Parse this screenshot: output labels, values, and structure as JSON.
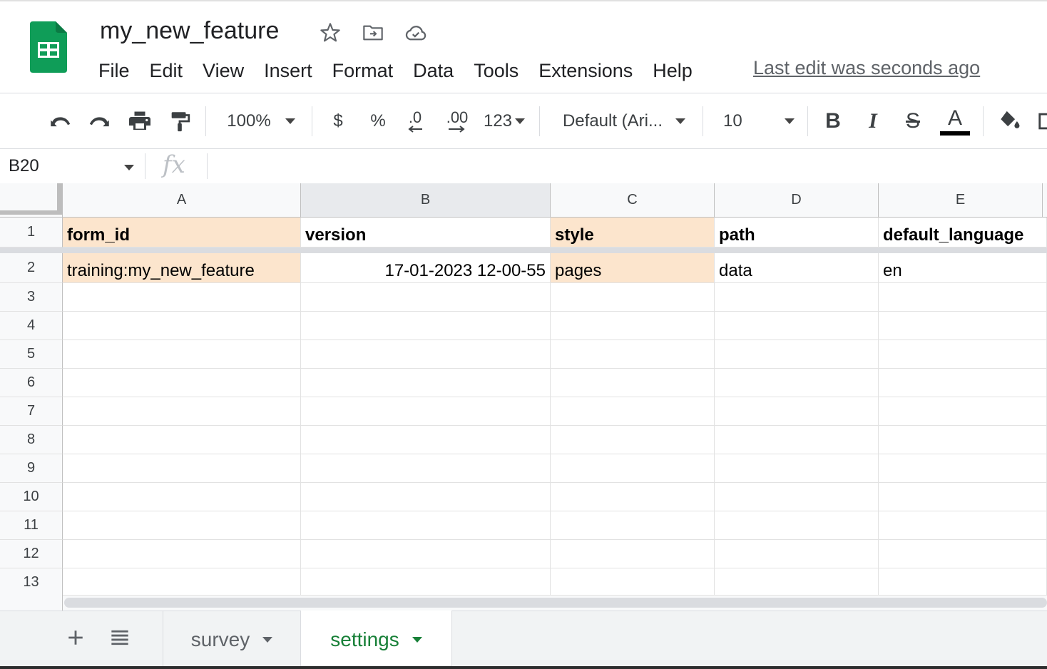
{
  "header": {
    "doc_title": "my_new_feature",
    "last_edit": "Last edit was seconds ago",
    "menu": [
      "File",
      "Edit",
      "View",
      "Insert",
      "Format",
      "Data",
      "Tools",
      "Extensions",
      "Help"
    ]
  },
  "toolbar": {
    "zoom": "100%",
    "currency": "$",
    "percent": "%",
    "decrease_decimal": ".0",
    "increase_decimal": ".00",
    "more_formats": "123",
    "font": "Default (Ari...",
    "font_size": "10",
    "bold": "B",
    "italic": "I",
    "strike": "S",
    "text_color": "A"
  },
  "formula_bar": {
    "name_box": "B20",
    "fx": "fx",
    "value": ""
  },
  "grid": {
    "columns": [
      "A",
      "B",
      "C",
      "D",
      "E"
    ],
    "rows": [
      "1",
      "2",
      "3",
      "4",
      "5",
      "6",
      "7",
      "8",
      "9",
      "10",
      "11",
      "12",
      "13"
    ],
    "cells": [
      [
        "form_id",
        "version",
        "style",
        "path",
        "default_language"
      ],
      [
        "training:my_new_feature",
        "17-01-2023 12-00-55",
        "pages",
        "data",
        "en"
      ]
    ],
    "selected_column": "B"
  },
  "sheets": [
    {
      "name": "survey",
      "active": false
    },
    {
      "name": "settings",
      "active": true
    }
  ],
  "colors": {
    "sheets_green": "#0f9d58",
    "peach_fill": "#fce5cd",
    "active_tab_text": "#188038"
  }
}
